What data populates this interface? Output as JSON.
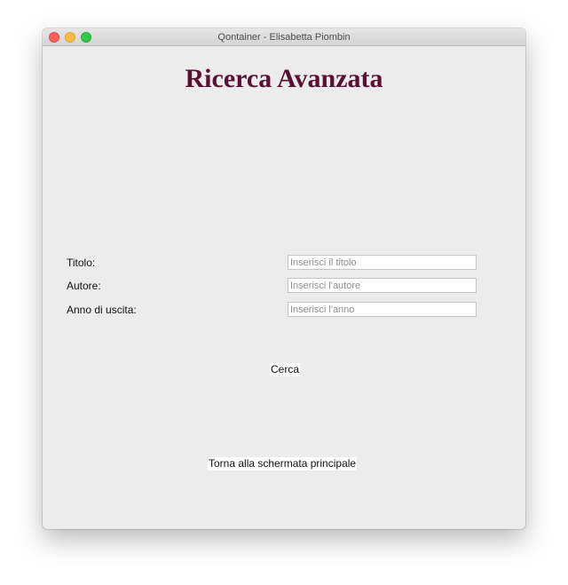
{
  "window": {
    "title": "Qontainer - Elisabetta Piombin"
  },
  "page": {
    "title": "Ricerca Avanzata"
  },
  "form": {
    "fields": [
      {
        "label": "Titolo:",
        "placeholder": "Inserisci il titolo",
        "value": ""
      },
      {
        "label": "Autore:",
        "placeholder": "Inserisci l'autore",
        "value": ""
      },
      {
        "label": "Anno di uscita:",
        "placeholder": "Inserisci l'anno",
        "value": ""
      }
    ]
  },
  "actions": {
    "search_label": "Cerca",
    "back_label": "Torna alla schermata principale"
  },
  "colors": {
    "title": "#5a1033",
    "window_bg": "#ececec",
    "close": "#fc605c",
    "minimize": "#fdbc40",
    "zoom": "#34c84a"
  }
}
